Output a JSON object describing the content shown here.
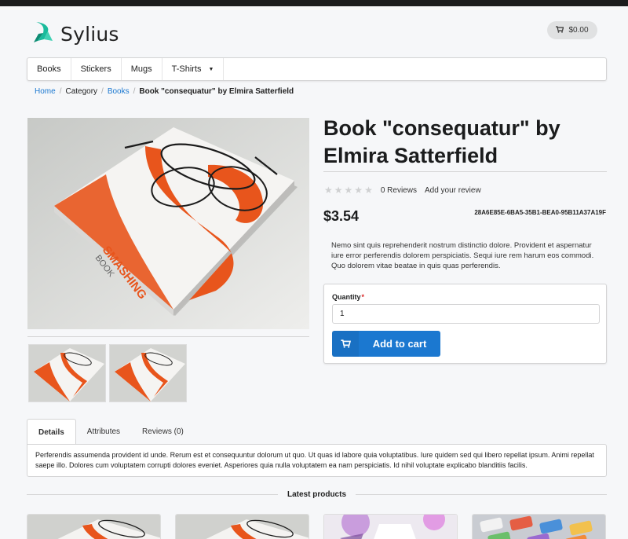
{
  "header": {
    "logo_text": "Sylius",
    "cart_total": "$0.00"
  },
  "menu": {
    "items": [
      {
        "label": "Books"
      },
      {
        "label": "Stickers"
      },
      {
        "label": "Mugs"
      },
      {
        "label": "T-Shirts",
        "has_dropdown": true
      }
    ]
  },
  "breadcrumb": {
    "items": [
      "Home",
      "Category",
      "Books"
    ],
    "current": "Book \"consequatur\" by Elmira Satterfield"
  },
  "product": {
    "title": "Book \"consequatur\" by Elmira Satterfield",
    "rating": 0,
    "reviews_label": "0 Reviews",
    "add_review_label": "Add your review",
    "price": "$3.54",
    "code": "28A6E85E-6BA5-35B1-BEA0-95B11A37A19F",
    "description": "Nemo sint quis reprehenderit nostrum distinctio dolore. Provident et aspernatur iure error perferendis dolorem perspiciatis. Sequi iure rem harum eos commodi. Quo dolorem vitae beatae in quis quas perferendis.",
    "cover_text": "SMASHING",
    "cover_subtext": "BOOK"
  },
  "cart_form": {
    "quantity_label": "Quantity",
    "quantity_value": "1",
    "add_to_cart_label": "Add to cart"
  },
  "tabs": {
    "items": [
      {
        "label": "Details"
      },
      {
        "label": "Attributes"
      },
      {
        "label": "Reviews (0)"
      }
    ],
    "details_text": "Perferendis assumenda provident id unde. Rerum est et consequuntur dolorum ut quo. Ut quas id labore quia voluptatibus. Iure quidem sed qui libero repellat ipsum. Animi repellat saepe illo. Dolores cum voluptatem corrupti dolores eveniet. Asperiores quia nulla voluptatem ea nam perspiciatis. Id nihil voluptate explicabo blanditiis facilis."
  },
  "latest": {
    "heading": "Latest products"
  },
  "colors": {
    "accent": "#1b78d0",
    "brand": "#1abb9c",
    "book_orange": "#e8551c"
  }
}
